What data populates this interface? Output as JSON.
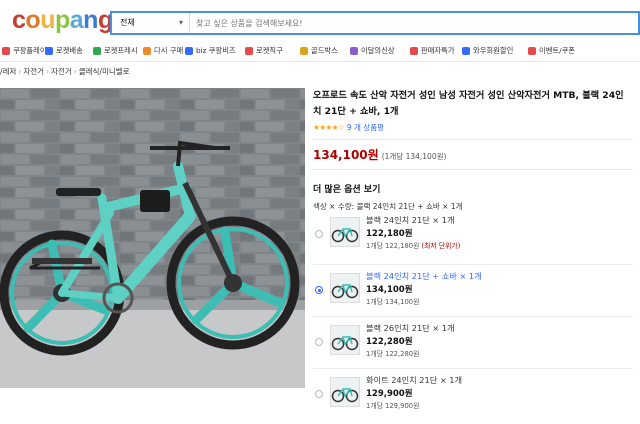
{
  "header": {
    "logo": "coupang",
    "logo_colors": [
      "#c73c2e",
      "#e07b2b",
      "#f2b33d",
      "#8cc63f",
      "#5aa9d6",
      "#3a7bd5",
      "#c73c2e"
    ],
    "search_category": "전체",
    "search_placeholder": "찾고 싶은 상품을 검색해보세요!"
  },
  "nav": [
    {
      "label": "쿠팡플레이",
      "color": "#e34a4a"
    },
    {
      "label": "로켓배송",
      "color": "#346aff"
    },
    {
      "label": "로켓프레시",
      "color": "#2fa84f"
    },
    {
      "label": "다시 구매",
      "color": "#f08c2e"
    },
    {
      "label": "biz 쿠팡비즈",
      "color": "#346aff"
    },
    {
      "label": "로켓직구",
      "color": "#e34a4a"
    },
    {
      "label": "골드박스",
      "color": "#d9a520"
    },
    {
      "label": "이달의신상",
      "color": "#8a5cd0"
    },
    {
      "label": "판매자특가",
      "color": "#e34a4a"
    },
    {
      "label": "와우회원할인",
      "color": "#346aff"
    },
    {
      "label": "이벤트/쿠폰",
      "color": "#e34a4a"
    }
  ],
  "breadcrumb": [
    "/레저",
    "자전거",
    "자전거",
    "클래식/미니벨로"
  ],
  "product": {
    "title": "오프로드 속도 산악 자전거 성인 남성 자전거 성인 산악자전거 MTB, 블랙 24인치 21단 + 쇼바, 1개",
    "rating_stars": 4,
    "reviews": "9 개 상품평",
    "price": "134,100원",
    "unit_price": "(1개당 134,100원)",
    "more_options": "더 많은 옵션 보기",
    "selected_option": "색상 × 수량: 블랙 24인치 21단 + 쇼바 × 1개"
  },
  "options": [
    {
      "name": "블랙 24인치 21단 × 1개",
      "price": "122,180원",
      "unit": "1개당 122,180원",
      "best": "(최저 단위가)",
      "selected": false
    },
    {
      "name": "블랙 24인치 21단 + 쇼바 × 1개",
      "price": "134,100원",
      "unit": "1개당 134,100원",
      "best": "",
      "selected": true
    },
    {
      "name": "블랙 26인치 21단 × 1개",
      "price": "122,280원",
      "unit": "1개당 122,280원",
      "best": "",
      "selected": false
    },
    {
      "name": "화이트 24인치 21단 × 1개",
      "price": "129,900원",
      "unit": "1개당 129,900원",
      "best": "",
      "selected": false
    }
  ],
  "colors": {
    "accent": "#346aff",
    "price": "#ae0000",
    "bike": "#5ed0c4",
    "brick": "#7d8186"
  }
}
